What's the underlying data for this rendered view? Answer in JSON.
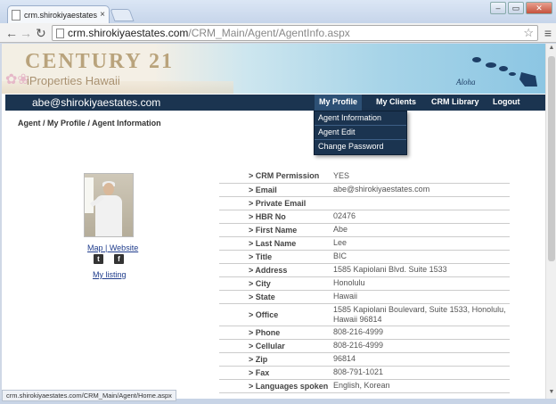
{
  "browser": {
    "tab_title": "crm.shirokiyaestates.com/C",
    "tab_close": "×",
    "url_host": "crm.shirokiyaestates.com",
    "url_path": "/CRM_Main/Agent/AgentInfo.aspx",
    "status_url": "crm.shirokiyaestates.com/CRM_Main/Agent/Home.aspx"
  },
  "banner": {
    "logo": "CENTURY 21",
    "sublogo": "iProperties Hawaii",
    "aloha": "Aloha"
  },
  "navbar": {
    "user_email": "abe@shirokiyaestates.com",
    "items": [
      "My Profile",
      "My Clients",
      "CRM Library",
      "Logout"
    ]
  },
  "dropdown": [
    "Agent Information",
    "Agent Edit",
    "Change Password"
  ],
  "breadcrumb": "Agent / My Profile / Agent Information",
  "sidebar": {
    "map_website": "Map | Website",
    "my_listing": "My listing",
    "twitter": "t",
    "facebook": "f"
  },
  "agent_info": [
    {
      "label": "> CRM Permission",
      "value": "YES"
    },
    {
      "label": "> Email",
      "value": "abe@shirokiyaestates.com"
    },
    {
      "label": "> Private Email",
      "value": ""
    },
    {
      "label": "> HBR No",
      "value": "02476"
    },
    {
      "label": "> First Name",
      "value": "Abe"
    },
    {
      "label": "> Last Name",
      "value": "Lee"
    },
    {
      "label": "> Title",
      "value": "BIC"
    },
    {
      "label": "> Address",
      "value": "1585 Kapiolani Blvd. Suite 1533"
    },
    {
      "label": "> City",
      "value": "Honolulu"
    },
    {
      "label": "> State",
      "value": "Hawaii"
    },
    {
      "label": "> Office",
      "value": "1585 Kapiolani Boulevard, Suite 1533, Honolulu, Hawaii 96814"
    },
    {
      "label": "> Phone",
      "value": "808-216-4999"
    },
    {
      "label": "> Cellular",
      "value": "808-216-4999"
    },
    {
      "label": "> Zip",
      "value": "96814"
    },
    {
      "label": "> Fax",
      "value": "808-791-1021"
    },
    {
      "label": "> Languages spoken",
      "value": "English, Korean"
    }
  ],
  "colors": {
    "navbar": "#1b3450",
    "link": "#1f3c8c",
    "logo": "#b9a37c"
  }
}
